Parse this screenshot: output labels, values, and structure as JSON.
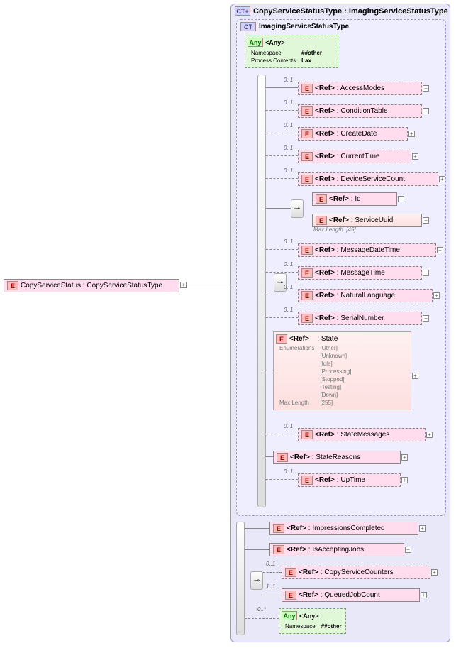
{
  "root": {
    "badge": "E",
    "label": "CopyServiceStatus : CopyServiceStatusType"
  },
  "outer": {
    "badge": "CT+",
    "title": "CopyServiceStatusType : ImagingServiceStatusType"
  },
  "inner": {
    "badge": "CT",
    "title": "ImagingServiceStatusType"
  },
  "any_top": {
    "badge": "Any",
    "label": "<Any>",
    "ns_label": "Namespace",
    "ns_value": "##other",
    "pc_label": "Process Contents",
    "pc_value": "Lax"
  },
  "refs": {
    "access_modes": {
      "badge": "E",
      "ref": "<Ref>",
      "name": ": AccessModes",
      "card": "0..1"
    },
    "condition_table": {
      "badge": "E",
      "ref": "<Ref>",
      "name": ": ConditionTable",
      "card": "0..1"
    },
    "create_date": {
      "badge": "E",
      "ref": "<Ref>",
      "name": ": CreateDate",
      "card": "0..1"
    },
    "current_time": {
      "badge": "E",
      "ref": "<Ref>",
      "name": ": CurrentTime",
      "card": "0..1"
    },
    "device_svc_cnt": {
      "badge": "E",
      "ref": "<Ref>",
      "name": ": DeviceServiceCount",
      "card": "0..1"
    },
    "id": {
      "badge": "E",
      "ref": "<Ref>",
      "name": ": Id"
    },
    "service_uuid": {
      "badge": "E",
      "ref": "<Ref>",
      "name": ": ServiceUuid",
      "maxlen_label": "Max Length",
      "maxlen": "[45]"
    },
    "msg_datetime": {
      "badge": "E",
      "ref": "<Ref>",
      "name": ": MessageDateTime",
      "card": "0..1"
    },
    "msg_time": {
      "badge": "E",
      "ref": "<Ref>",
      "name": ": MessageTime",
      "card": "0..1"
    },
    "nat_lang": {
      "badge": "E",
      "ref": "<Ref>",
      "name": ": NaturalLanguage",
      "card": "0..1"
    },
    "serial_number": {
      "badge": "E",
      "ref": "<Ref>",
      "name": ": SerialNumber",
      "card": "0..1"
    },
    "state": {
      "badge": "E",
      "ref": "<Ref>",
      "name": ": State",
      "enum_label": "Enumerations",
      "enums": [
        "[Other]",
        "[Unknown]",
        "[Idle]",
        "[Processing]",
        "[Stopped]",
        "[Testing]",
        "[Down]"
      ],
      "maxlen_label": "Max Length",
      "maxlen": "[255]"
    },
    "state_messages": {
      "badge": "E",
      "ref": "<Ref>",
      "name": ": StateMessages",
      "card": "0..1"
    },
    "state_reasons": {
      "badge": "E",
      "ref": "<Ref>",
      "name": ": StateReasons"
    },
    "uptime": {
      "badge": "E",
      "ref": "<Ref>",
      "name": ": UpTime",
      "card": "0..1"
    },
    "impressions": {
      "badge": "E",
      "ref": "<Ref>",
      "name": ": ImpressionsCompleted"
    },
    "accepting": {
      "badge": "E",
      "ref": "<Ref>",
      "name": ": IsAcceptingJobs"
    },
    "copy_counters": {
      "badge": "E",
      "ref": "<Ref>",
      "name": ": CopyServiceCounters",
      "card": "0..1"
    },
    "queued": {
      "badge": "E",
      "ref": "<Ref>",
      "name": ": QueuedJobCount",
      "card": "1..1"
    },
    "any_bottom": {
      "badge": "Any",
      "ref": "<Any>",
      "ns_label": "Namespace",
      "ns_value": "##other",
      "card": "0..*"
    }
  }
}
